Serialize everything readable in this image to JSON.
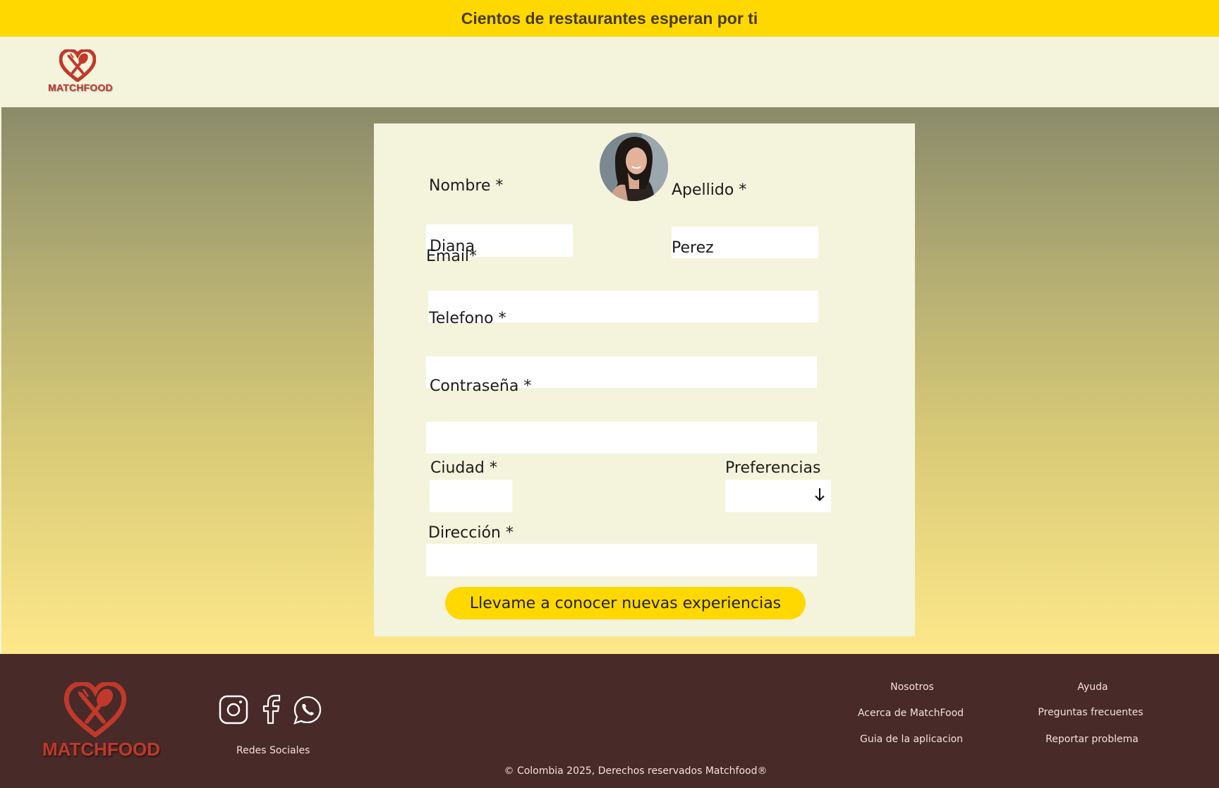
{
  "banner": {
    "text": "Cientos de restaurantes esperan por ti"
  },
  "header": {
    "logo_text": "MATCHFOOD"
  },
  "form": {
    "nombre_label": "Nombre *",
    "nombre_value": "Diana",
    "apellido_label": "Apellido *",
    "apellido_value": "Perez",
    "email_label": "Email*",
    "email_value": "",
    "telefono_label": "Telefono *",
    "telefono_value": "",
    "contrasena_label": "Contraseña *",
    "contrasena_value": "",
    "ciudad_label": "Ciudad *",
    "ciudad_value": "",
    "preferencias_label": "Preferencias",
    "preferencias_value": "",
    "direccion_label": "Dirección *",
    "direccion_value": "",
    "submit_label": "Llevame a conocer nuevas experiencias"
  },
  "footer": {
    "logo_text": "MATCHFOOD",
    "social_label": "Redes Sociales",
    "social_icons": [
      "instagram-icon",
      "facebook-icon",
      "whatsapp-icon"
    ],
    "col1": {
      "heading": "Nosotros",
      "links": [
        "Acerca de MatchFood",
        "Guia de la aplicacion"
      ]
    },
    "col2": {
      "heading": "Ayuda",
      "links": [
        "Preguntas frecuentes",
        "Reportar problema"
      ]
    },
    "copyright": "© Colombia 2025, Derechos reservados Matchfood®"
  },
  "colors": {
    "banner": "#ffd800",
    "cream": "#f4f4dc",
    "brand_red": "#c0392b",
    "footer_bg": "#482a28",
    "button": "#ffd800"
  }
}
